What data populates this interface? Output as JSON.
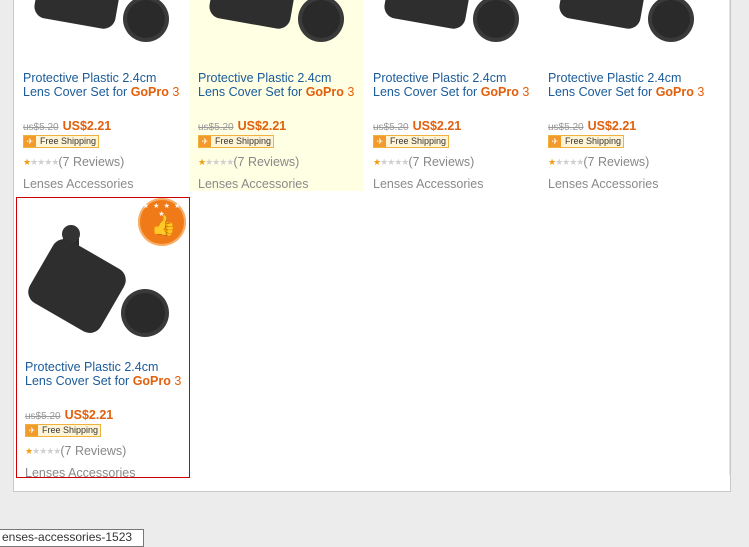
{
  "products": [
    {
      "title": "Protective Plastic 2.4cm Lens Cover Set for",
      "brand": "GoPro",
      "model": "3",
      "old_price": "us$5.20",
      "price": "US$2.21",
      "shipping": "Free Shipping",
      "reviews": "(7 Reviews)",
      "category": "Lenses Accessories",
      "rating": 1.5
    },
    {
      "title": "Protective Plastic 2.4cm Lens Cover Set for",
      "brand": "GoPro",
      "model": "3",
      "old_price": "us$5.20",
      "price": "US$2.21",
      "shipping": "Free Shipping",
      "reviews": "(7 Reviews)",
      "category": "Lenses Accessories",
      "rating": 1.5
    },
    {
      "title": "Protective Plastic 2.4cm Lens Cover Set for",
      "brand": "GoPro",
      "model": "3",
      "old_price": "us$5.20",
      "price": "US$2.21",
      "shipping": "Free Shipping",
      "reviews": "(7 Reviews)",
      "category": "Lenses Accessories",
      "rating": 1.5
    },
    {
      "title": "Protective Plastic 2.4cm Lens Cover Set for",
      "brand": "GoPro",
      "model": "3",
      "old_price": "us$5.20",
      "price": "US$2.21",
      "shipping": "Free Shipping",
      "reviews": "(7 Reviews)",
      "category": "Lenses Accessories",
      "rating": 1.5
    },
    {
      "title": "Protective Plastic 2.4cm Lens Cover Set for",
      "brand": "GoPro",
      "model": "3",
      "old_price": "us$5.20",
      "price": "US$2.21",
      "shipping": "Free Shipping",
      "reviews": "(7 Reviews)",
      "category": "Lenses Accessories",
      "rating": 1.5
    }
  ],
  "tooltip": "enses-accessories-1523",
  "colors": {
    "link": "#1a5b9a",
    "accent": "#e2600c",
    "selected_border": "#cc0000",
    "highlight": "#ffffe3"
  },
  "icons": {
    "shipping": "airplane-icon",
    "badge": "thumbs-up-badge-icon",
    "scroll_down": "chevron-down-icon"
  }
}
